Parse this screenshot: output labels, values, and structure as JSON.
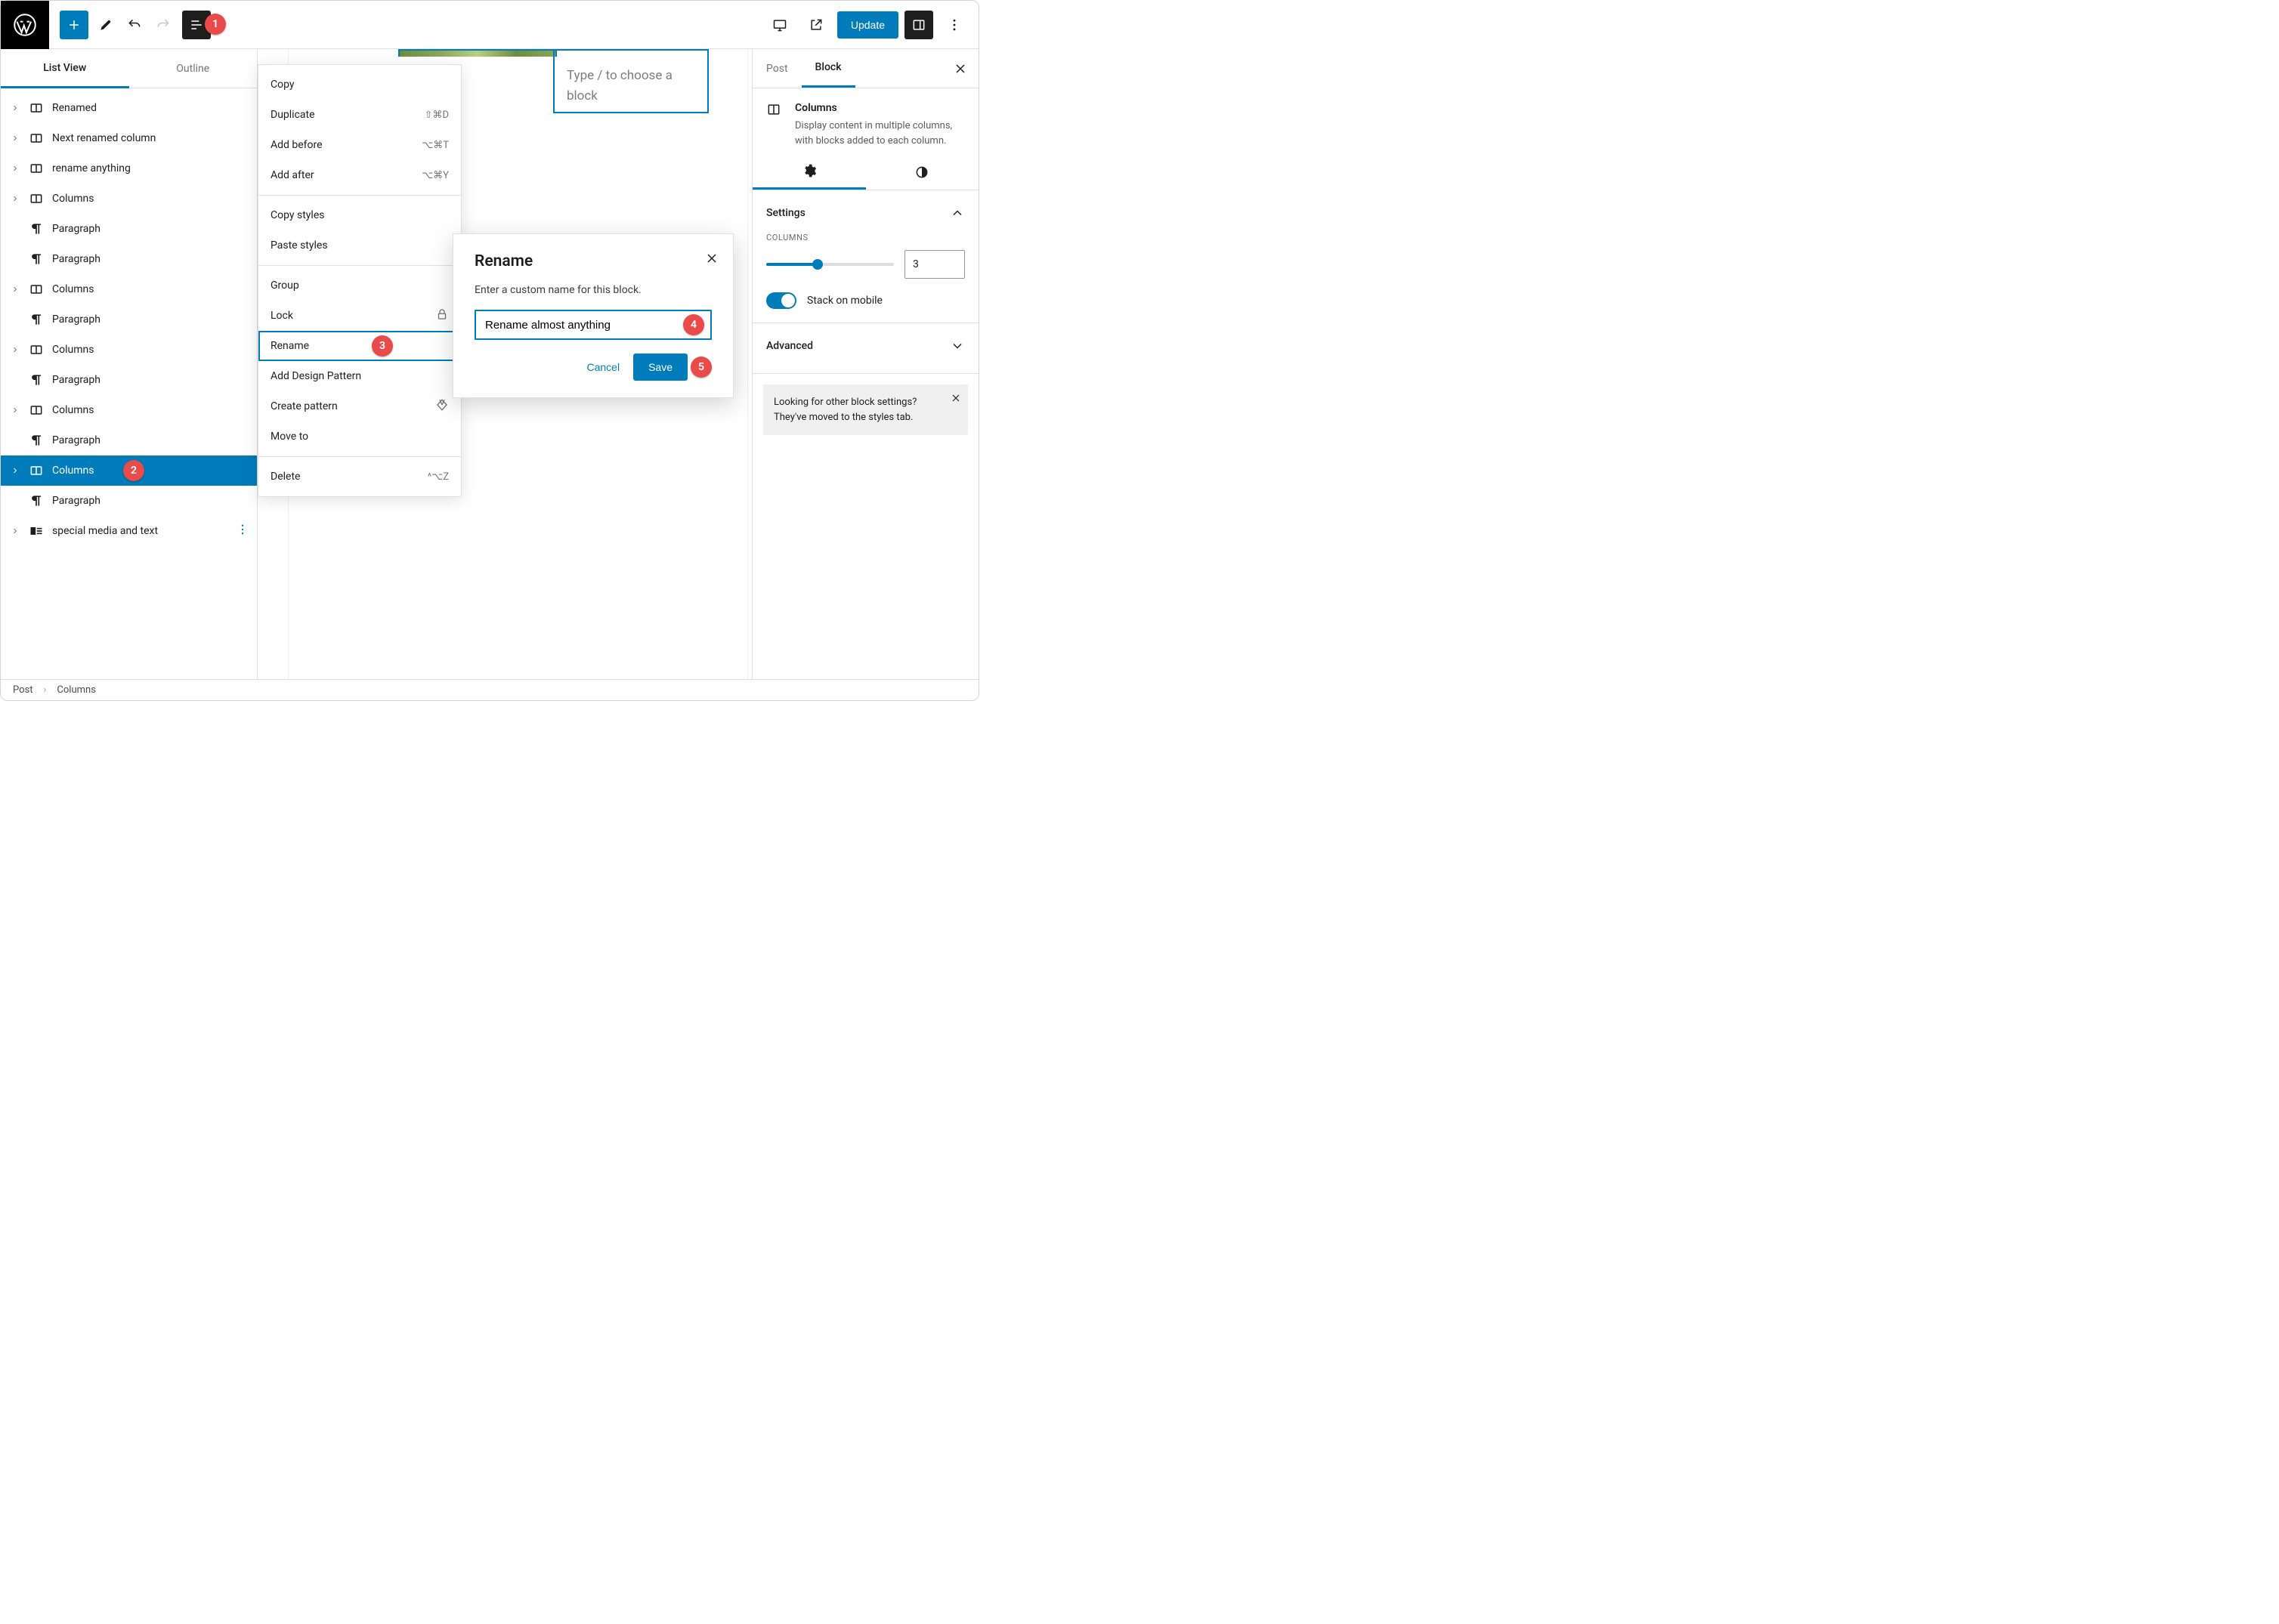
{
  "toolbar": {
    "update_label": "Update"
  },
  "leftpanel": {
    "tabs": {
      "list": "List View",
      "outline": "Outline"
    },
    "items": [
      {
        "icon": "columns",
        "label": "Renamed",
        "caret": true,
        "selected": false
      },
      {
        "icon": "columns",
        "label": "Next renamed column",
        "caret": true,
        "selected": false
      },
      {
        "icon": "columns",
        "label": "rename anything",
        "caret": true,
        "selected": false
      },
      {
        "icon": "columns",
        "label": "Columns",
        "caret": true,
        "selected": false
      },
      {
        "icon": "paragraph",
        "label": "Paragraph",
        "caret": false,
        "selected": false
      },
      {
        "icon": "paragraph",
        "label": "Paragraph",
        "caret": false,
        "selected": false
      },
      {
        "icon": "columns",
        "label": "Columns",
        "caret": true,
        "selected": false
      },
      {
        "icon": "paragraph",
        "label": "Paragraph",
        "caret": false,
        "selected": false
      },
      {
        "icon": "columns",
        "label": "Columns",
        "caret": true,
        "selected": false
      },
      {
        "icon": "paragraph",
        "label": "Paragraph",
        "caret": false,
        "selected": false
      },
      {
        "icon": "columns",
        "label": "Columns",
        "caret": true,
        "selected": false
      },
      {
        "icon": "paragraph",
        "label": "Paragraph",
        "caret": false,
        "selected": false
      },
      {
        "icon": "columns",
        "label": "Columns",
        "caret": true,
        "selected": true
      },
      {
        "icon": "paragraph",
        "label": "Paragraph",
        "caret": false,
        "selected": false
      },
      {
        "icon": "media",
        "label": "special media and text",
        "caret": true,
        "selected": false,
        "kebab": true
      }
    ]
  },
  "canvas": {
    "placeholder": "Type / to choose a block"
  },
  "context_menu": {
    "groups": [
      [
        {
          "label": "Copy",
          "shortcut": ""
        },
        {
          "label": "Duplicate",
          "shortcut": "⇧⌘D"
        },
        {
          "label": "Add before",
          "shortcut": "⌥⌘T"
        },
        {
          "label": "Add after",
          "shortcut": "⌥⌘Y"
        }
      ],
      [
        {
          "label": "Copy styles",
          "shortcut": ""
        },
        {
          "label": "Paste styles",
          "shortcut": ""
        }
      ],
      [
        {
          "label": "Group",
          "shortcut": ""
        },
        {
          "label": "Lock",
          "shortcut": "",
          "icon": "lock"
        },
        {
          "label": "Rename",
          "shortcut": "",
          "highlight": true
        },
        {
          "label": "Add Design Pattern",
          "shortcut": ""
        },
        {
          "label": "Create pattern",
          "shortcut": "",
          "icon": "diamond"
        },
        {
          "label": "Move to",
          "shortcut": ""
        }
      ],
      [
        {
          "label": "Delete",
          "shortcut": "^⌥Z"
        }
      ]
    ]
  },
  "modal": {
    "title": "Rename",
    "prompt": "Enter a custom name for this block.",
    "value": "Rename almost anything",
    "cancel": "Cancel",
    "save": "Save"
  },
  "inspector": {
    "tabs": {
      "post": "Post",
      "block": "Block"
    },
    "block_name": "Columns",
    "block_desc": "Display content in multiple columns, with blocks added to each column.",
    "settings_label": "Settings",
    "columns_label": "COLUMNS",
    "columns_value": "3",
    "slider_percent": 40,
    "stack_label": "Stack on mobile",
    "advanced_label": "Advanced",
    "note": "Looking for other block settings? They've moved to the styles tab."
  },
  "footer": {
    "crumb1": "Post",
    "crumb2": "Columns"
  },
  "steps": {
    "s1": "1",
    "s2": "2",
    "s3": "3",
    "s4": "4",
    "s5": "5"
  }
}
